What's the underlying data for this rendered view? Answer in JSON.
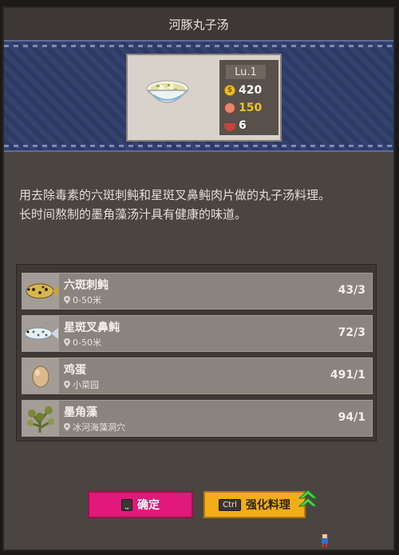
{
  "title": "河豚丸子汤",
  "card": {
    "level": "Lu.1",
    "price": "420",
    "taste": "150",
    "servings": "6",
    "icons": [
      "food-bowl-icon",
      "coin-icon",
      "taste-face-icon",
      "serving-bowl-icon"
    ],
    "colors": {
      "price": "#ffffff",
      "taste": "#f2c023",
      "servings": "#ffffff"
    }
  },
  "description": [
    "用去除毒素的六斑刺鲀和星斑叉鼻鲀肉片做的丸子汤料理。",
    "长时间熬制的墨角藻汤汁具有健康的味道。"
  ],
  "ingredients": [
    {
      "name": "六斑刺鲀",
      "location": "0-50米",
      "count": "43/3",
      "icon": "porcupinefish-icon"
    },
    {
      "name": "星斑叉鼻鲀",
      "location": "0-50米",
      "count": "72/3",
      "icon": "pufferfish-icon"
    },
    {
      "name": "鸡蛋",
      "location": "小菜园",
      "count": "491/1",
      "icon": "egg-icon"
    },
    {
      "name": "墨角藻",
      "location": "冰河海藻洞穴",
      "count": "94/1",
      "icon": "seaweed-icon"
    }
  ],
  "buttons": {
    "confirm_key": "⎵",
    "confirm_label": "确定",
    "upgrade_key": "Ctrl",
    "upgrade_label": "强化料理"
  }
}
